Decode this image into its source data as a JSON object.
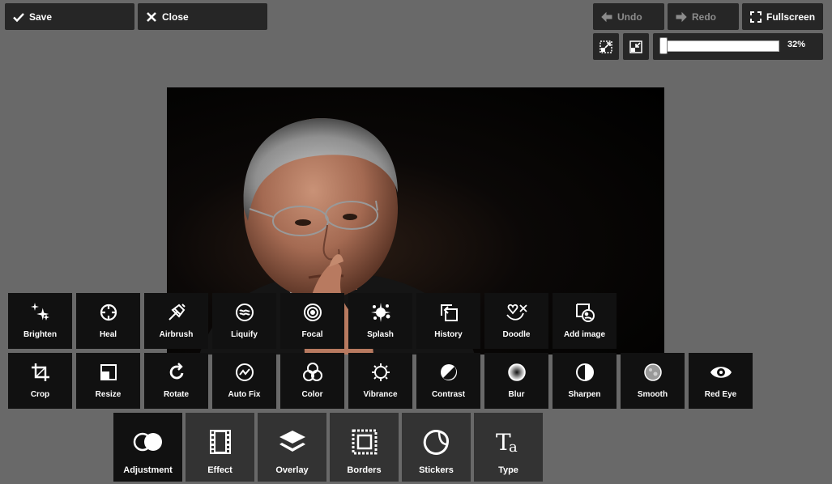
{
  "toolbar": {
    "save_label": "Save",
    "close_label": "Close",
    "undo_label": "Undo",
    "redo_label": "Redo",
    "fullscreen_label": "Fullscreen"
  },
  "zoom": {
    "value_label": "32%",
    "value_fraction": 0.32
  },
  "tools_row1": [
    {
      "label": "Brighten",
      "icon": "sparkles-icon"
    },
    {
      "label": "Heal",
      "icon": "heal-icon"
    },
    {
      "label": "Airbrush",
      "icon": "airbrush-icon"
    },
    {
      "label": "Liquify",
      "icon": "liquify-icon"
    },
    {
      "label": "Focal",
      "icon": "focal-target-icon"
    },
    {
      "label": "Splash",
      "icon": "splash-icon"
    },
    {
      "label": "History",
      "icon": "history-icon"
    },
    {
      "label": "Doodle",
      "icon": "doodle-icon"
    },
    {
      "label": "Add image",
      "icon": "add-image-icon"
    }
  ],
  "tools_row2": [
    {
      "label": "Crop",
      "icon": "crop-icon"
    },
    {
      "label": "Resize",
      "icon": "resize-icon"
    },
    {
      "label": "Rotate",
      "icon": "rotate-icon"
    },
    {
      "label": "Auto Fix",
      "icon": "auto-fix-icon"
    },
    {
      "label": "Color",
      "icon": "color-circles-icon"
    },
    {
      "label": "Vibrance",
      "icon": "vibrance-icon"
    },
    {
      "label": "Contrast",
      "icon": "contrast-icon"
    },
    {
      "label": "Blur",
      "icon": "blur-icon"
    },
    {
      "label": "Sharpen",
      "icon": "sharpen-icon"
    },
    {
      "label": "Smooth",
      "icon": "smooth-icon"
    },
    {
      "label": "Red Eye",
      "icon": "eye-icon"
    }
  ],
  "categories": [
    {
      "label": "Adjustment",
      "icon": "adjustment-icon",
      "active": true
    },
    {
      "label": "Effect",
      "icon": "film-icon",
      "active": false
    },
    {
      "label": "Overlay",
      "icon": "layers-icon",
      "active": false
    },
    {
      "label": "Borders",
      "icon": "border-frame-icon",
      "active": false
    },
    {
      "label": "Stickers",
      "icon": "sticker-icon",
      "active": false
    },
    {
      "label": "Type",
      "icon": "type-icon",
      "active": false
    }
  ]
}
